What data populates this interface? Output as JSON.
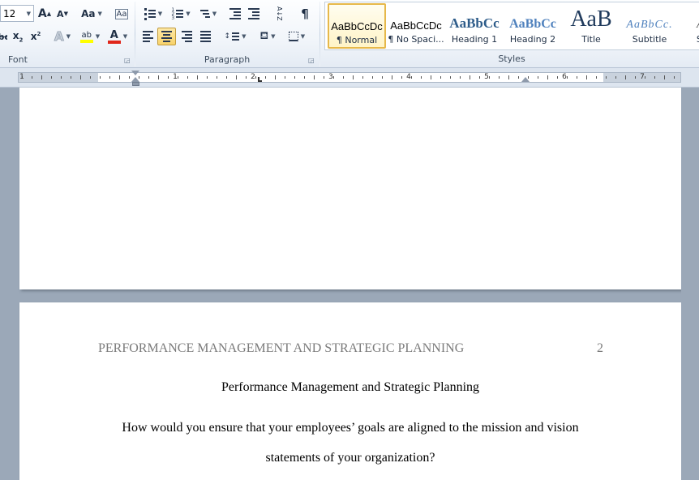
{
  "ribbon": {
    "font_group": {
      "label": "Font",
      "font_size": "12",
      "grow_glyph": "A",
      "shrink_glyph": "A",
      "change_case": "Aa",
      "clear_format": "Aa",
      "strike_glyph": "abc",
      "sub_glyph": "x",
      "sub_sub": "2",
      "sup_glyph": "x",
      "sup_sup": "2",
      "effects_glyph": "A",
      "highlight_glyph": "ab",
      "highlight_color": "#ffff00",
      "font_color_glyph": "A",
      "font_color": "#e0261a"
    },
    "paragraph_group": {
      "label": "Paragraph",
      "sort_glyph": "A↓Z",
      "pilcrow": "¶"
    },
    "styles_group": {
      "label": "Styles",
      "items": [
        {
          "sample": "AaBbCcDc",
          "name": "¶ Normal"
        },
        {
          "sample": "AaBbCcDc",
          "name": "¶ No Spaci..."
        },
        {
          "sample": "AaBbCc",
          "name": "Heading 1"
        },
        {
          "sample": "AaBbCc",
          "name": "Heading 2"
        },
        {
          "sample": "AaB",
          "name": "Title"
        },
        {
          "sample": "AaBbCc.",
          "name": "Subtitle"
        },
        {
          "sample": "AaBl",
          "name": "Subtl"
        }
      ]
    }
  },
  "ruler": {
    "numbers": [
      "1",
      "1",
      "2",
      "3",
      "4",
      "5",
      "6",
      "7"
    ]
  },
  "document": {
    "running_head": "PERFORMANCE MANAGEMENT AND STRATEGIC PLANNING",
    "page_number": "2",
    "title": "Performance Management and Strategic Planning",
    "question_line1": "How would you ensure that your employees’ goals are aligned to the mission and vision",
    "question_line2": "statements of your organization?"
  }
}
